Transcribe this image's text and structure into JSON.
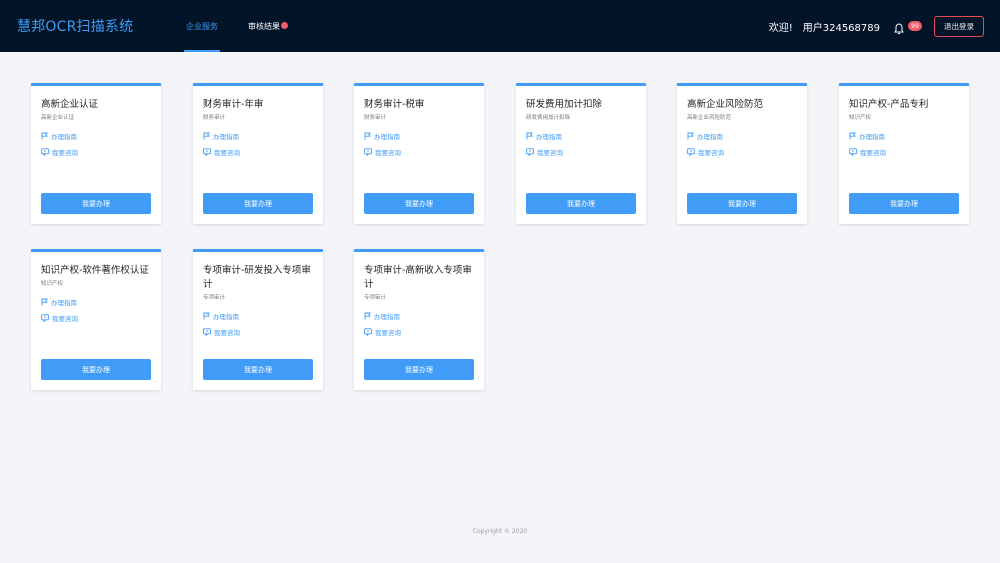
{
  "header": {
    "brand": "慧邦OCR扫描系统",
    "nav": [
      {
        "label": "企业服务",
        "active": true
      },
      {
        "label": "审核结果",
        "active": false
      }
    ],
    "welcome": "欢迎!",
    "username": "用户324568789",
    "notification_count": "99",
    "logout_label": "退出登录",
    "icons": {
      "bell": "bell-icon"
    }
  },
  "cards": [
    {
      "title": "高新企业认证",
      "subtitle": "高新企业认证",
      "guide": "办理指南",
      "consult": "我要咨询",
      "action": "我要办理"
    },
    {
      "title": "财务审计-年审",
      "subtitle": "财务审计",
      "guide": "办理指南",
      "consult": "我要咨询",
      "action": "我要办理"
    },
    {
      "title": "财务审计-税审",
      "subtitle": "财务审计",
      "guide": "办理指南",
      "consult": "我要咨询",
      "action": "我要办理"
    },
    {
      "title": "研发费用加计扣除",
      "subtitle": "研发费用加计扣除",
      "guide": "办理指南",
      "consult": "我要咨询",
      "action": "我要办理"
    },
    {
      "title": "高新企业风险防范",
      "subtitle": "高新企业风险防范",
      "guide": "办理指南",
      "consult": "我要咨询",
      "action": "我要办理"
    },
    {
      "title": "知识产权-产品专利",
      "subtitle": "知识产权",
      "guide": "办理指南",
      "consult": "我要咨询",
      "action": "我要办理"
    },
    {
      "title": "知识产权-软件著作权认证",
      "subtitle": "知识产权",
      "guide": "办理指南",
      "consult": "我要咨询",
      "action": "我要办理"
    },
    {
      "title": "专项审计-研发投入专项审计",
      "subtitle": "专项审计",
      "guide": "办理指南",
      "consult": "我要咨询",
      "action": "我要办理"
    },
    {
      "title": "专项审计-高新收入专项审计",
      "subtitle": "专项审计",
      "guide": "办理指南",
      "consult": "我要咨询",
      "action": "我要办理"
    }
  ],
  "footer": {
    "copyright": "Copyright © 2020"
  },
  "colors": {
    "header_bg": "#021428",
    "accent": "#409cf7",
    "danger": "#f25c6b",
    "page_bg": "#f3f5f9"
  }
}
